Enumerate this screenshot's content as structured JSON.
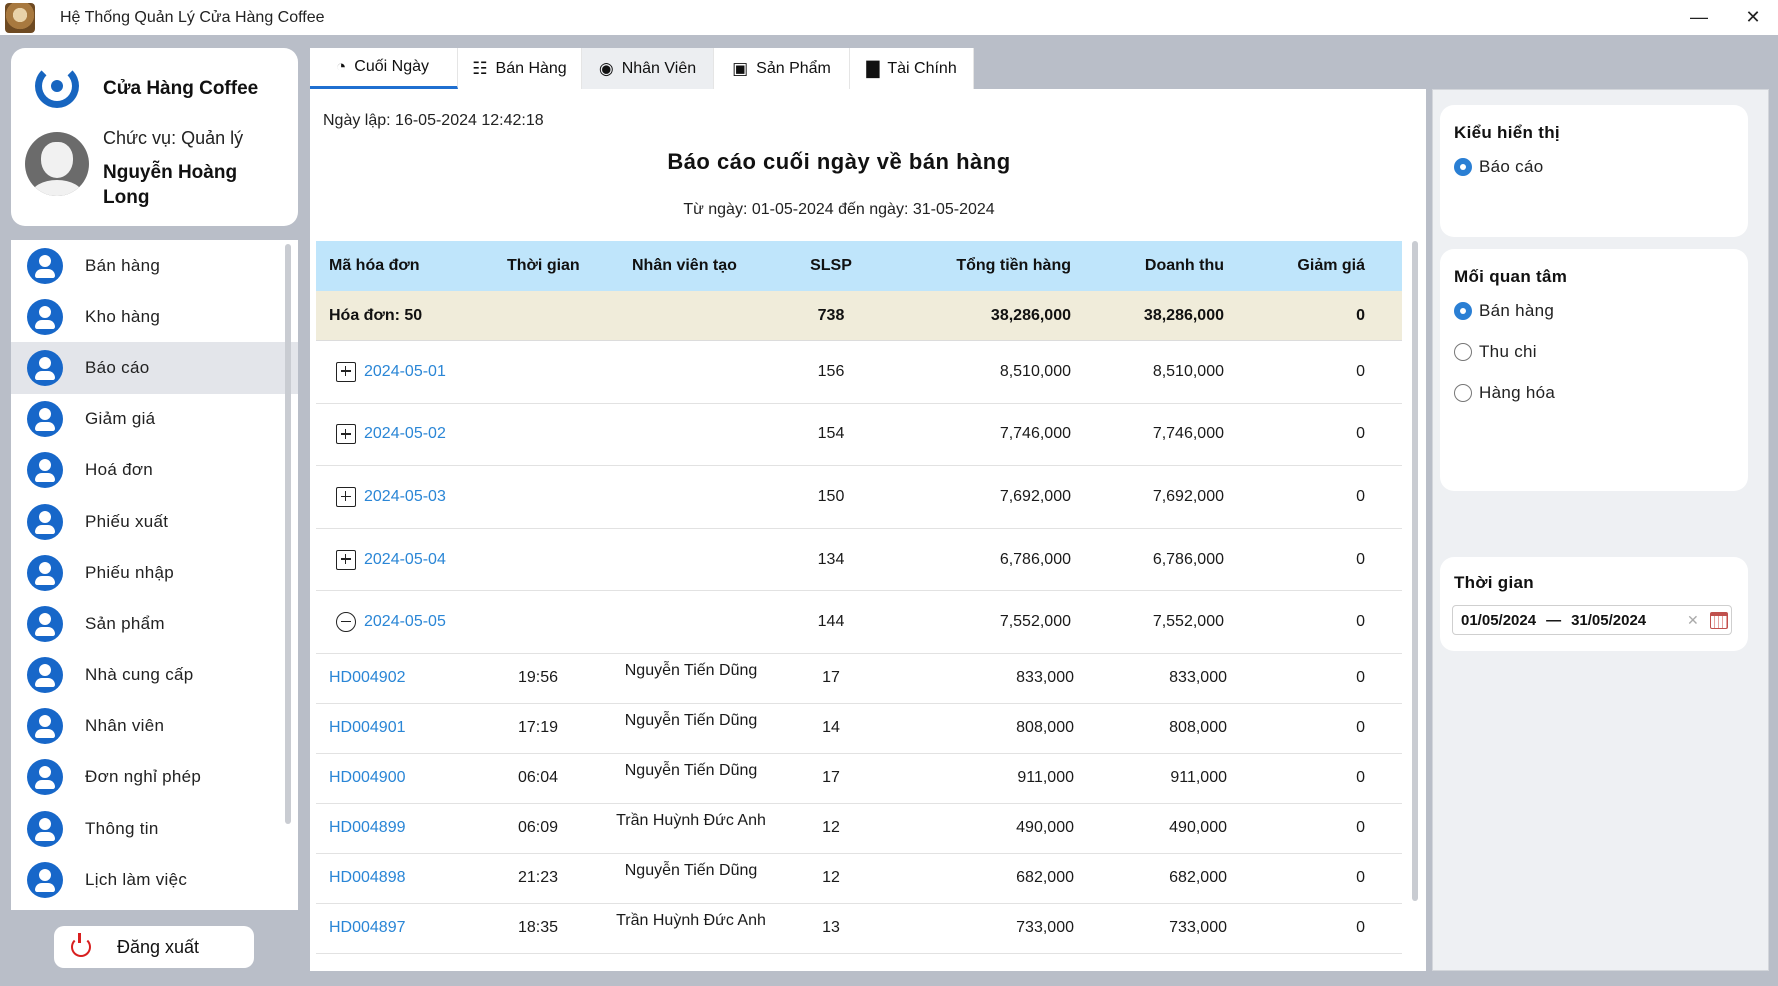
{
  "window": {
    "title": "Hệ Thống Quản Lý Cửa Hàng Coffee",
    "minimize_icon": "minimize-icon",
    "close_icon": "close-icon"
  },
  "profile": {
    "brand": "Cửa Hàng Coffee",
    "role": "Chức vụ: Quản lý",
    "name": "Nguyễn Hoàng Long"
  },
  "sidebar": {
    "active_index": 2,
    "items": [
      {
        "label": "Bán hàng"
      },
      {
        "label": "Kho hàng"
      },
      {
        "label": "Báo cáo"
      },
      {
        "label": "Giảm giá"
      },
      {
        "label": "Hoá đơn"
      },
      {
        "label": "Phiếu xuất"
      },
      {
        "label": "Phiếu nhập"
      },
      {
        "label": "Sản phẩm"
      },
      {
        "label": "Nhà cung cấp"
      },
      {
        "label": "Nhân viên"
      },
      {
        "label": "Đơn nghỉ phép"
      },
      {
        "label": "Thông tin"
      },
      {
        "label": "Lịch làm việc"
      }
    ],
    "logout_label": "Đăng xuất"
  },
  "tabs": [
    {
      "label": "Cuối Ngày",
      "icon": "pie-chart-icon"
    },
    {
      "label": "Bán Hàng",
      "icon": "receipt-icon"
    },
    {
      "label": "Nhân Viên",
      "icon": "person-icon"
    },
    {
      "label": "Sản Phẩm",
      "icon": "box-icon"
    },
    {
      "label": "Tài Chính",
      "icon": "finance-chart-icon"
    }
  ],
  "report": {
    "created": "Ngày lập: 16-05-2024 12:42:18",
    "title": "Báo cáo cuối ngày về bán hàng",
    "range": "Từ ngày: 01-05-2024 đến ngày: 31-05-2024",
    "columns": [
      "Mã hóa đơn",
      "Thời gian",
      "Nhân viên tạo",
      "SLSP",
      "Tổng tiền hàng",
      "Doanh thu",
      "Giảm giá"
    ],
    "summary": {
      "label": "Hóa đơn: 50",
      "qty": "738",
      "total": "38,286,000",
      "revenue": "38,286,000",
      "discount": "0"
    },
    "groups": [
      {
        "date": "2024-05-01",
        "expanded": false,
        "qty": "156",
        "total": "8,510,000",
        "revenue": "8,510,000",
        "discount": "0"
      },
      {
        "date": "2024-05-02",
        "expanded": false,
        "qty": "154",
        "total": "7,746,000",
        "revenue": "7,746,000",
        "discount": "0"
      },
      {
        "date": "2024-05-03",
        "expanded": false,
        "qty": "150",
        "total": "7,692,000",
        "revenue": "7,692,000",
        "discount": "0"
      },
      {
        "date": "2024-05-04",
        "expanded": false,
        "qty": "134",
        "total": "6,786,000",
        "revenue": "6,786,000",
        "discount": "0"
      },
      {
        "date": "2024-05-05",
        "expanded": true,
        "qty": "144",
        "total": "7,552,000",
        "revenue": "7,552,000",
        "discount": "0"
      }
    ],
    "invoices": [
      {
        "id": "HD004902",
        "time": "19:56",
        "staff": "Nguyễn Tiến Dũng",
        "qty": "17",
        "total": "833,000",
        "revenue": "833,000",
        "discount": "0"
      },
      {
        "id": "HD004901",
        "time": "17:19",
        "staff": "Nguyễn Tiến Dũng",
        "qty": "14",
        "total": "808,000",
        "revenue": "808,000",
        "discount": "0"
      },
      {
        "id": "HD004900",
        "time": "06:04",
        "staff": "Nguyễn Tiến Dũng",
        "qty": "17",
        "total": "911,000",
        "revenue": "911,000",
        "discount": "0"
      },
      {
        "id": "HD004899",
        "time": "06:09",
        "staff": "Trần Huỳnh Đức Anh",
        "qty": "12",
        "total": "490,000",
        "revenue": "490,000",
        "discount": "0"
      },
      {
        "id": "HD004898",
        "time": "21:23",
        "staff": "Nguyễn Tiến Dũng",
        "qty": "12",
        "total": "682,000",
        "revenue": "682,000",
        "discount": "0"
      },
      {
        "id": "HD004897",
        "time": "18:35",
        "staff": "Trần Huỳnh Đức Anh",
        "qty": "13",
        "total": "733,000",
        "revenue": "733,000",
        "discount": "0"
      }
    ]
  },
  "filters": {
    "display_title": "Kiểu hiển thị",
    "display_options": [
      {
        "label": "Báo cáo",
        "checked": true
      }
    ],
    "interest_title": "Mối quan tâm",
    "interest_options": [
      {
        "label": "Bán hàng",
        "checked": true
      },
      {
        "label": "Thu chi",
        "checked": false
      },
      {
        "label": "Hàng hóa",
        "checked": false
      }
    ],
    "time_title": "Thời gian",
    "date_from": "01/05/2024",
    "date_sep": "—",
    "date_to": "31/05/2024"
  }
}
